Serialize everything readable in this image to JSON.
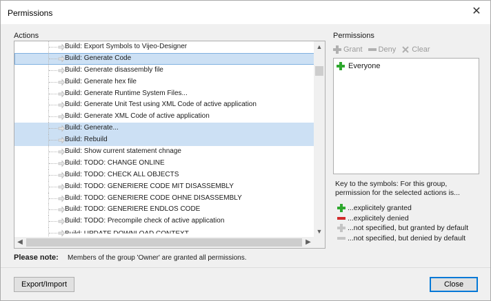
{
  "window": {
    "title": "Permissions",
    "close_glyph": "✕"
  },
  "actions": {
    "label": "Actions",
    "items": [
      {
        "label": "Build: Export Symbols to Vijeo-Designer",
        "state": "normal"
      },
      {
        "label": "Build: Generate Code",
        "state": "focused"
      },
      {
        "label": "Build: Generate disassembly file",
        "state": "normal"
      },
      {
        "label": "Build: Generate hex file",
        "state": "normal"
      },
      {
        "label": "Build: Generate Runtime System Files...",
        "state": "normal"
      },
      {
        "label": "Build: Generate Unit Test using XML Code of active application",
        "state": "normal"
      },
      {
        "label": "Build: Generate XML Code of active application",
        "state": "normal"
      },
      {
        "label": "Build: Generate...",
        "state": "selected"
      },
      {
        "label": "Build: Rebuild",
        "state": "selected"
      },
      {
        "label": "Build: Show current statement chnage",
        "state": "normal"
      },
      {
        "label": "Build: TODO: CHANGE ONLINE",
        "state": "normal"
      },
      {
        "label": "Build: TODO: CHECK ALL OBJECTS",
        "state": "normal"
      },
      {
        "label": "Build: TODO: GENERIERE CODE MIT DISASSEMBLY",
        "state": "normal"
      },
      {
        "label": "Build: TODO: GENERIERE CODE OHNE DISASSEMBLY",
        "state": "normal"
      },
      {
        "label": "Build: TODO: GENERIERE ENDLOS CODE",
        "state": "normal"
      },
      {
        "label": "Build: TODO: Precompile check of active application",
        "state": "normal"
      },
      {
        "label": "Build: UPDATE DOWNLOAD CONTEXT",
        "state": "partial"
      }
    ]
  },
  "permissions": {
    "label": "Permissions",
    "toolbar": {
      "grant": "Grant",
      "deny": "Deny",
      "clear": "Clear"
    },
    "groups": [
      {
        "label": "Everyone",
        "status": "granted"
      }
    ],
    "key_text": "Key to the symbols: For this group, permission for the selected actions is...",
    "legend": [
      {
        "icon": "plus-green-icon",
        "label": "...explicitely granted"
      },
      {
        "icon": "minus-red-icon",
        "label": "...explicitely denied"
      },
      {
        "icon": "plus-gray-icon",
        "label": "...not specified, but granted by default"
      },
      {
        "icon": "minus-gray-icon",
        "label": "...not specified, but denied by default"
      }
    ]
  },
  "note": {
    "label": "Please note:",
    "text": "Members of the group 'Owner' are granted all permissions."
  },
  "buttons": {
    "export_import": "Export/Import",
    "close": "Close"
  },
  "colors": {
    "granted": "#2ea82e",
    "denied": "#d12a2a",
    "inactive": "#b0b0b0",
    "selection": "#cce0f4"
  }
}
